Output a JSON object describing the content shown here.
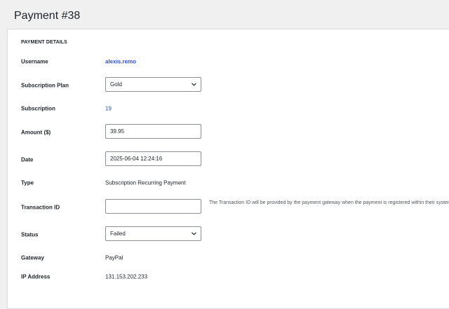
{
  "page": {
    "title": "Payment #38"
  },
  "section": {
    "title": "PAYMENT DETAILS"
  },
  "fields": {
    "username": {
      "label": "Username",
      "value": "alexis.remo"
    },
    "subscription_plan": {
      "label": "Subscription Plan",
      "value": "Gold"
    },
    "subscription": {
      "label": "Subscription",
      "value": "19"
    },
    "amount": {
      "label": "Amount ($)",
      "value": "39.95"
    },
    "date": {
      "label": "Date",
      "value": "2025-06-04 12:24:16"
    },
    "type": {
      "label": "Type",
      "value": "Subscription Recurring Payment"
    },
    "transaction_id": {
      "label": "Transaction ID",
      "value": "",
      "help": "The Transaction ID will be provided by the payment gateway when the payment is registered within their system."
    },
    "status": {
      "label": "Status",
      "value": "Failed"
    },
    "gateway": {
      "label": "Gateway",
      "value": "PayPal"
    },
    "ip_address": {
      "label": "IP Address",
      "value": "131.153.202.233"
    }
  },
  "colors": {
    "background": "#f0f0f1",
    "panel": "#ffffff",
    "link": "#2c4fd6",
    "border": "#8c8f94"
  },
  "icons": {
    "select_arrow": "chevron-down-icon"
  }
}
